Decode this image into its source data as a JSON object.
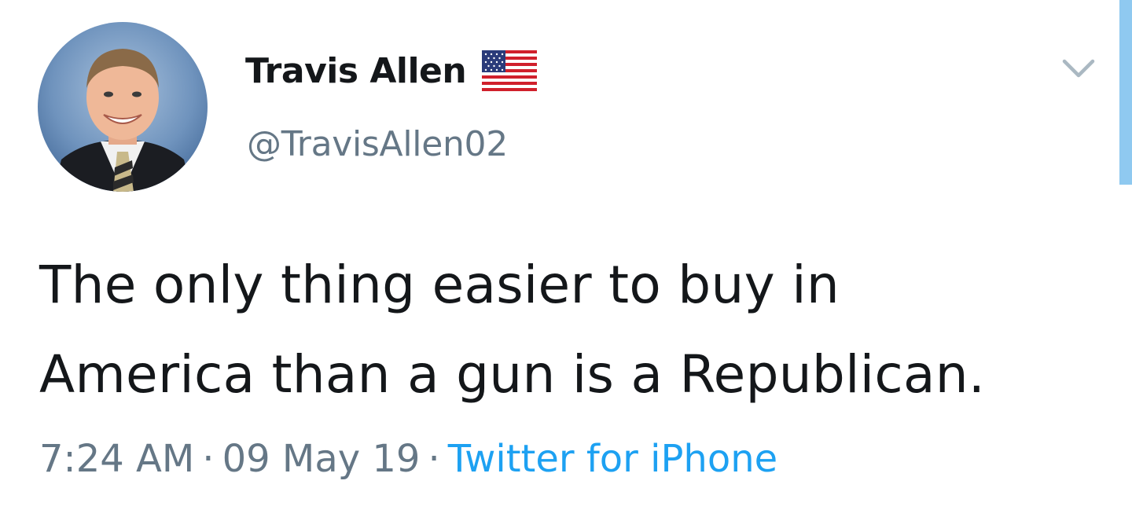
{
  "author": {
    "display_name": "Travis Allen",
    "flag_icon": "us-flag-icon",
    "handle": "@TravisAllen02"
  },
  "tweet": {
    "lines": [
      "The only thing easier to buy in",
      "America than a gun is a Republican."
    ]
  },
  "meta": {
    "time": "7:24 AM",
    "separator": "·",
    "date": "09 May 19",
    "source": "Twitter for iPhone"
  },
  "icons": {
    "menu": "chevron-down-icon"
  },
  "colors": {
    "text": "#14171a",
    "secondary": "#657786",
    "link": "#1da1f2",
    "scrollbar": "#8fc9f0"
  }
}
